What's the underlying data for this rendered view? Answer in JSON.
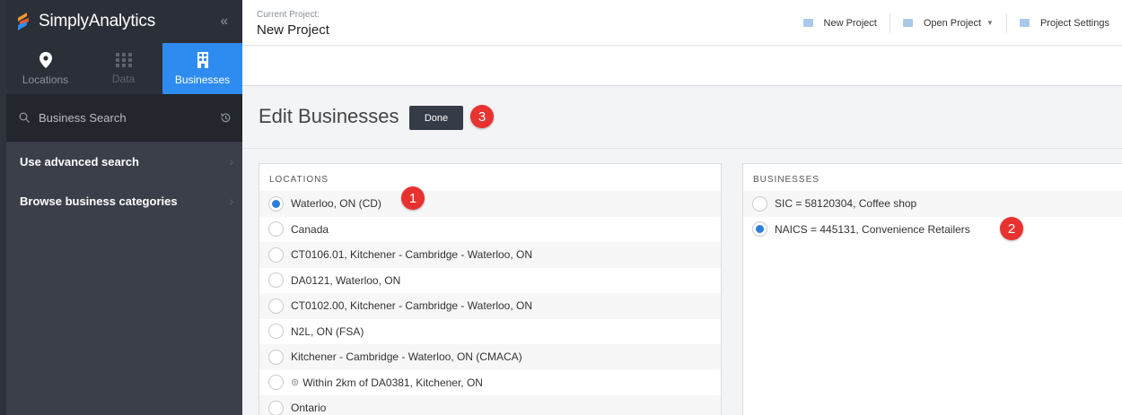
{
  "app": {
    "name": "SimplyAnalytics",
    "collapse_glyph": "«"
  },
  "nav": {
    "tabs": [
      {
        "label": "Locations",
        "icon": "map-pin-icon"
      },
      {
        "label": "Data",
        "icon": "grid-icon"
      },
      {
        "label": "Businesses",
        "icon": "building-icon",
        "active": true
      }
    ]
  },
  "search": {
    "placeholder": "Business Search"
  },
  "sidebar": {
    "items": [
      {
        "label": "Use advanced search"
      },
      {
        "label": "Browse business categories"
      }
    ]
  },
  "header": {
    "project_label": "Current Project:",
    "project_name": "New Project",
    "actions": {
      "new_project": "New Project",
      "open_project": "Open Project",
      "settings": "Project Settings"
    }
  },
  "editor": {
    "title": "Edit Businesses",
    "done_label": "Done"
  },
  "locations": {
    "heading": "LOCATIONS",
    "items": [
      "Waterloo, ON (CD)",
      "Canada",
      "CT0106.01, Kitchener - Cambridge - Waterloo, ON",
      "DA0121, Waterloo, ON",
      "CT0102.00, Kitchener - Cambridge - Waterloo, ON",
      "N2L, ON (FSA)",
      "Kitchener - Cambridge - Waterloo, ON (CMACA)",
      "Within 2km of DA0381, Kitchener, ON",
      "Ontario"
    ],
    "selected_index": 0
  },
  "businesses": {
    "heading": "BUSINESSES",
    "items": [
      "SIC = 58120304, Coffee shop",
      "NAICS = 445131, Convenience Retailers"
    ],
    "selected_index": 1
  },
  "callouts": [
    "1",
    "2",
    "3"
  ],
  "colors": {
    "accent": "#2e8cf0",
    "sidebar": "#3a3f4a",
    "badge": "#e8322f",
    "done_button": "#353b47"
  }
}
